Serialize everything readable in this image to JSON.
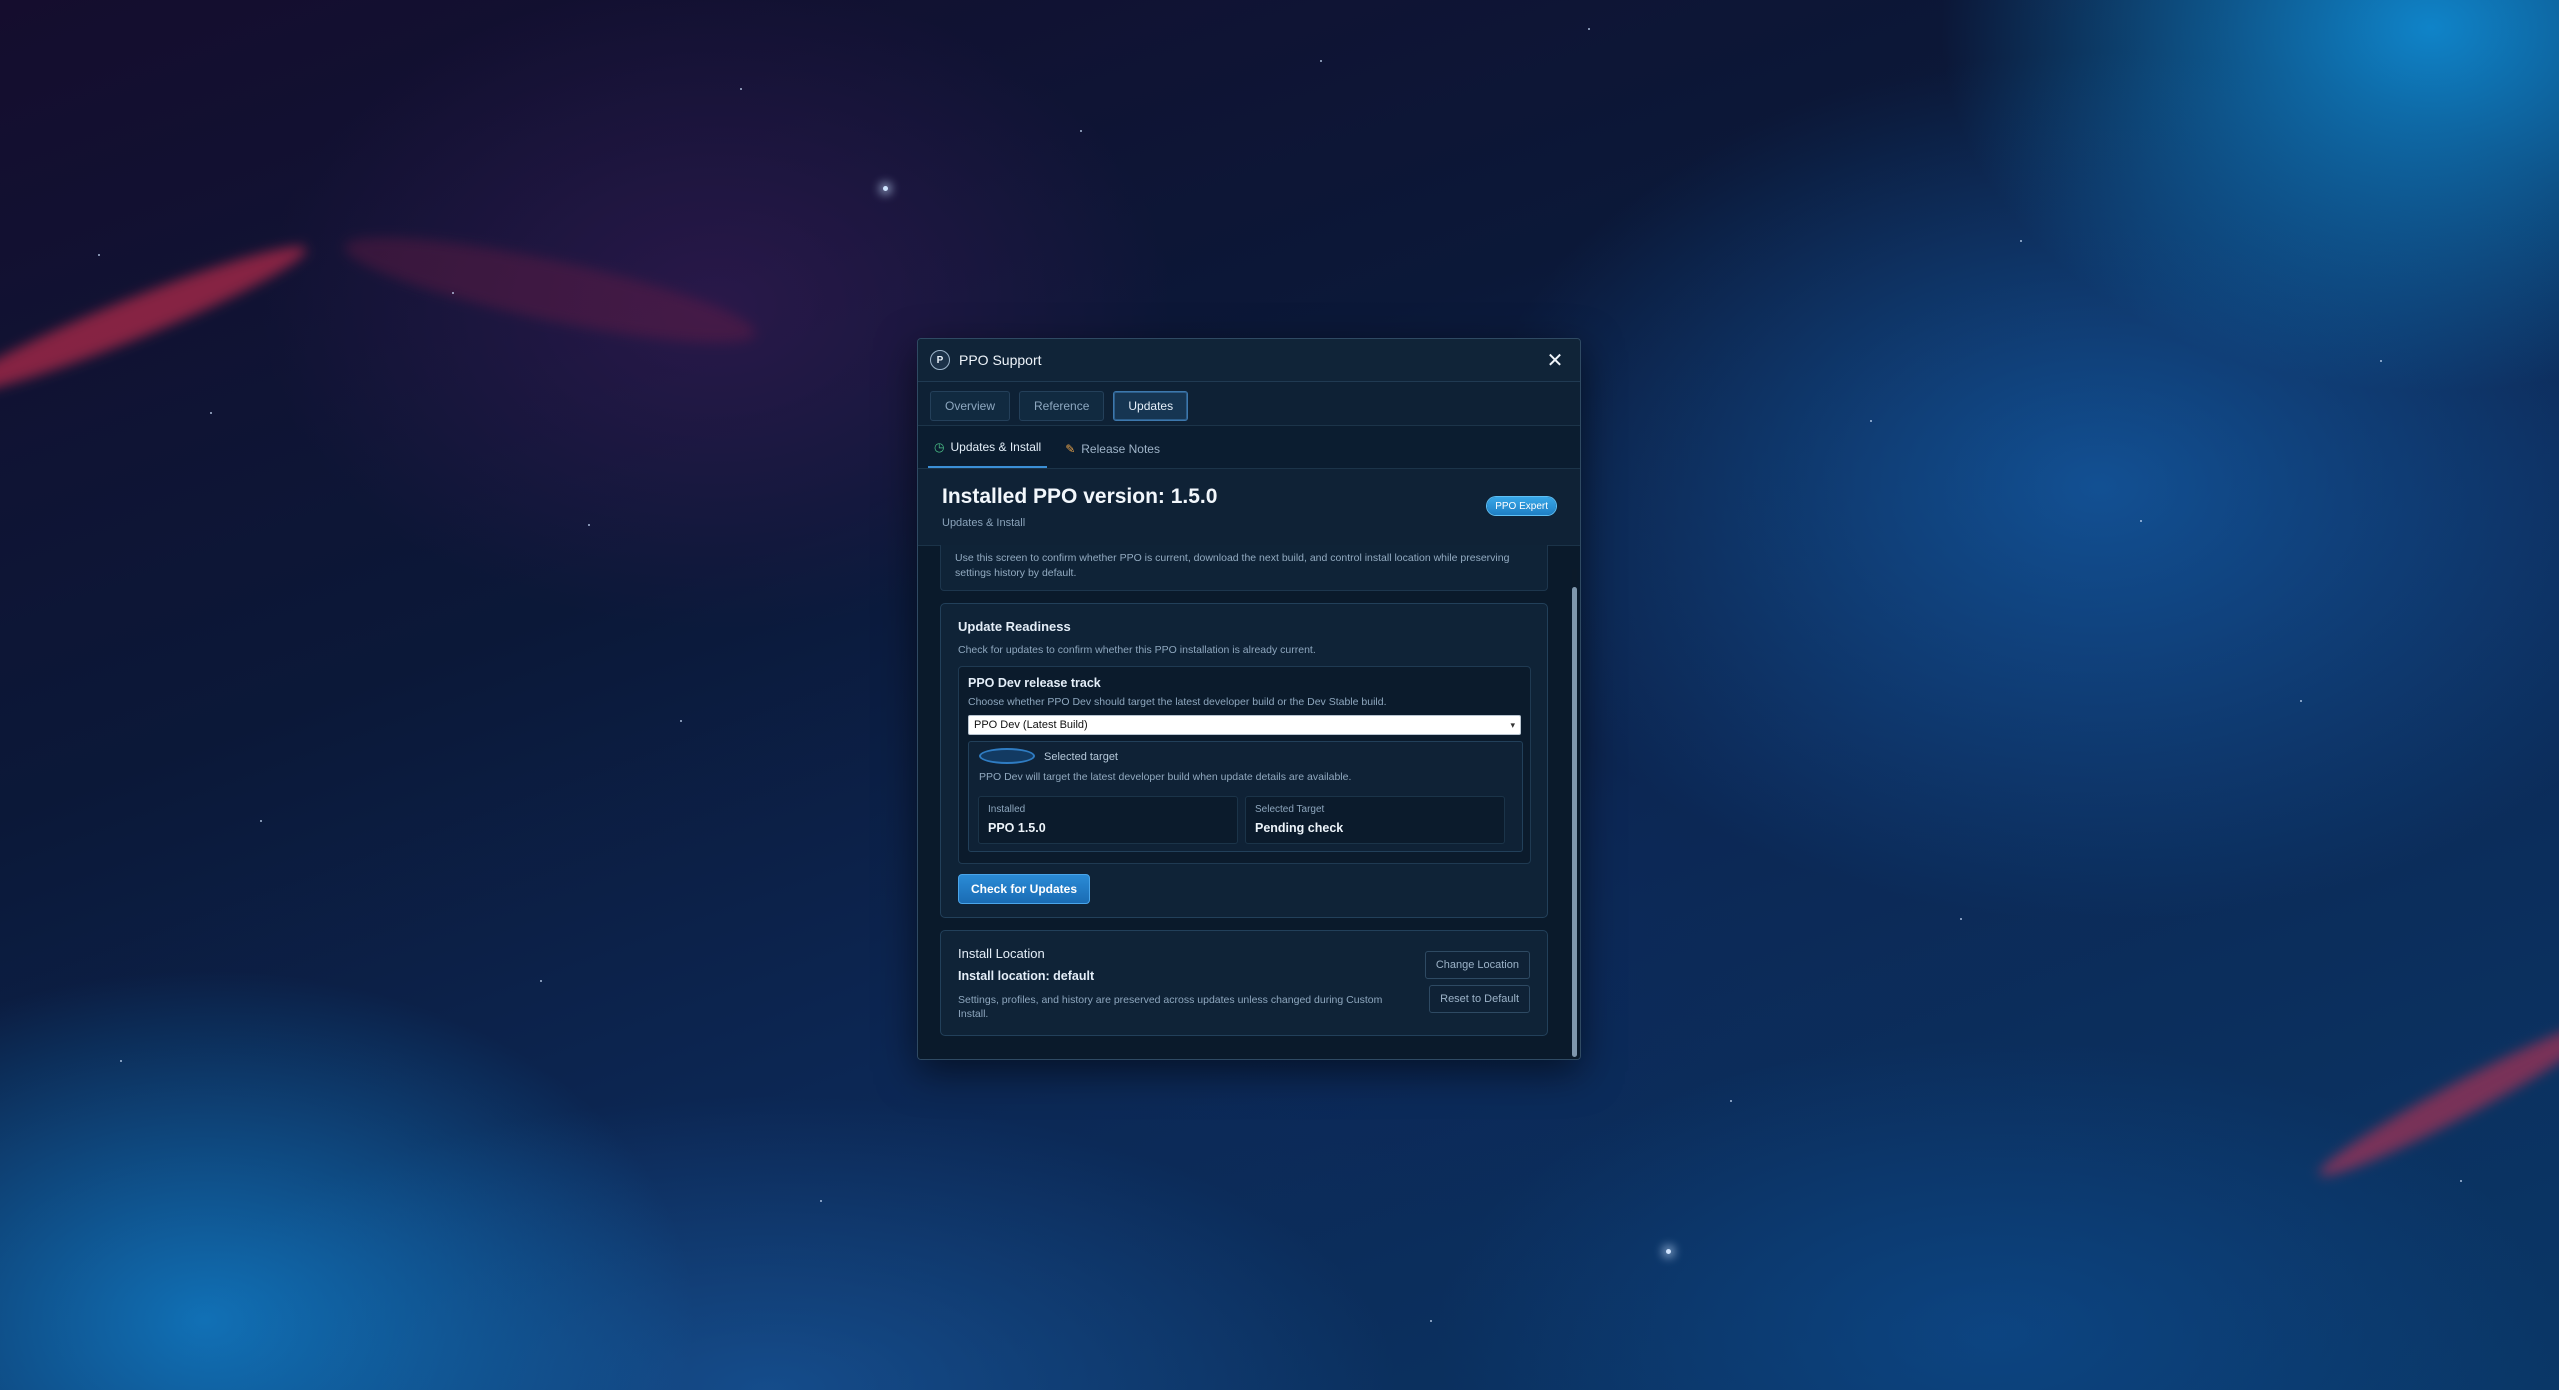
{
  "window": {
    "title": "PPO Support",
    "app_icon_letter": "P",
    "close_label": "✕"
  },
  "main_tabs": [
    {
      "label": "Overview",
      "active": false
    },
    {
      "label": "Reference",
      "active": false
    },
    {
      "label": "Updates",
      "active": true
    }
  ],
  "sub_tabs": [
    {
      "label": "Updates & Install",
      "icon": "clock-icon",
      "active": true
    },
    {
      "label": "Release Notes",
      "icon": "notes-icon",
      "active": false
    }
  ],
  "header": {
    "title": "Installed PPO version: 1.5.0",
    "subtitle": "Updates & Install",
    "badge": "PPO Expert"
  },
  "intro": {
    "text": "Use this screen to confirm whether PPO is current, download the next build, and control install location while preserving settings history by default."
  },
  "update_readiness": {
    "title": "Update Readiness",
    "description": "Check for updates to confirm whether this PPO installation is already current.",
    "release_track": {
      "title": "PPO Dev release track",
      "description": "Choose whether PPO Dev should target the latest developer build or the Dev Stable build.",
      "selected_option": "PPO Dev (Latest Build)"
    },
    "target": {
      "label": "Selected target",
      "description": "PPO Dev will target the latest developer build when update details are available.",
      "installed_label": "Installed",
      "installed_value": "PPO 1.5.0",
      "selected_target_label": "Selected Target",
      "selected_target_value": "Pending check"
    },
    "check_button": "Check for Updates"
  },
  "install_location": {
    "title": "Install Location",
    "location_text": "Install location: default",
    "description": "Settings, profiles, and history are preserved across updates unless changed during Custom Install.",
    "change_button": "Change Location",
    "reset_button": "Reset to Default"
  },
  "colors": {
    "accent": "#2a8bd6",
    "window_bg": "#0d2035",
    "clock_icon": "#4cc38a",
    "notes_icon": "#e7a24a"
  }
}
